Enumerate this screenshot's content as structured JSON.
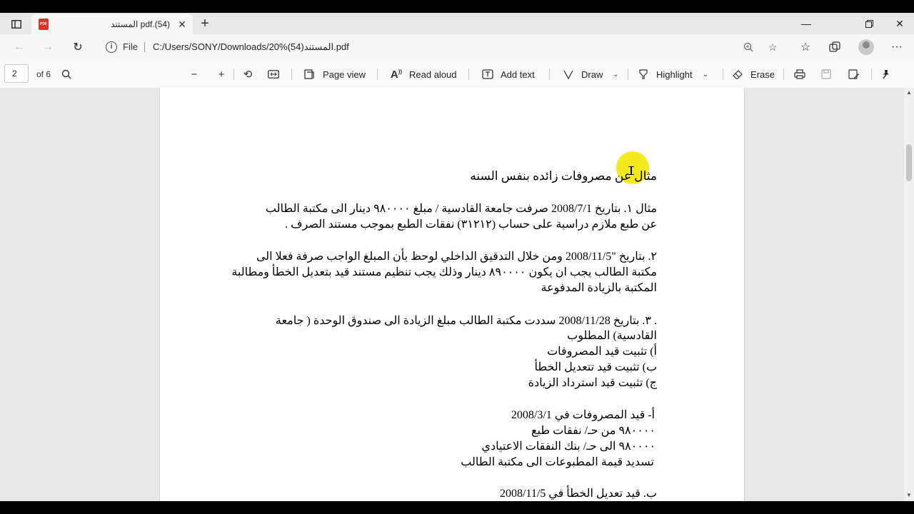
{
  "browser": {
    "tab_title": "pdf.(54) المستند",
    "pdf_badge": "PDF",
    "address_scheme": "File",
    "url": "C:/Users/SONY/Downloads/المستند(54)%20.pdf"
  },
  "pdf_toolbar": {
    "page_number": "2",
    "page_count": "of 6",
    "page_view": "Page view",
    "read_aloud": "Read aloud",
    "add_text": "Add text",
    "draw": "Draw",
    "highlight": "Highlight",
    "erase": "Erase"
  },
  "document": {
    "heading": "مثال عن مصروفات زائده  بنفس السنه",
    "ex1_line1": "مثال ١. بتاريخ 2008/7/1 صرفت جامعة القادسية / مبلغ ٩٨٠٠٠٠ دينار الى مكتبة الطالب",
    "ex1_line2": "عن طبع ملازم دراسية على حساب (٣١٢١٢) نفقات الطبع بموجب مستند الصرف .",
    "ex2_line1": "٢. بتاريخ \"2008/11/5 ومن خلال التدقيق الداخلي لوحظ بأن المبلغ الواجب صرفة فعلا الى",
    "ex2_line2": "مكتبة الطالب يجب ان يكون ٨٩٠٠٠٠ دينار وذلك يجب تنظيم مستند قيد بتعديل الخطأ ومطالبة",
    "ex2_line3": "المكتبة بالزيادة المدفوعة",
    "ex3_line1": ". ٣. بتاريخ 2008/11/28 سددت مكتبة الطالب مبلغ الزيادة الى صندوق الوحدة ( جامعة",
    "ex3_line2": "القادسية) المطلوب",
    "req_a": "أ) تثبيت قيد المصروفات",
    "req_b": "ب) تثبيت قيد تتعديل الخطأ",
    "req_c": "ج) تثبيت قيد استرداد الزيادة",
    "entry_a_title": "أ- قيد المصروفات في 2008/3/1",
    "entry_a_dr": "٩٨٠٠٠٠ من حـ/ نفقات طبع",
    "entry_a_cr": "٩٨٠٠٠٠ الى حـ/ بنك النفقات الاعتيادي",
    "entry_a_note": "تسديد قيمة المطبوعات الى مكتبة الطالب",
    "entry_b_title": "ب. قيد تعديل الخطأ في 2008/11/5"
  },
  "colors": {
    "highlight": "#f5ea1e",
    "pdf_icon": "#d9342b"
  }
}
